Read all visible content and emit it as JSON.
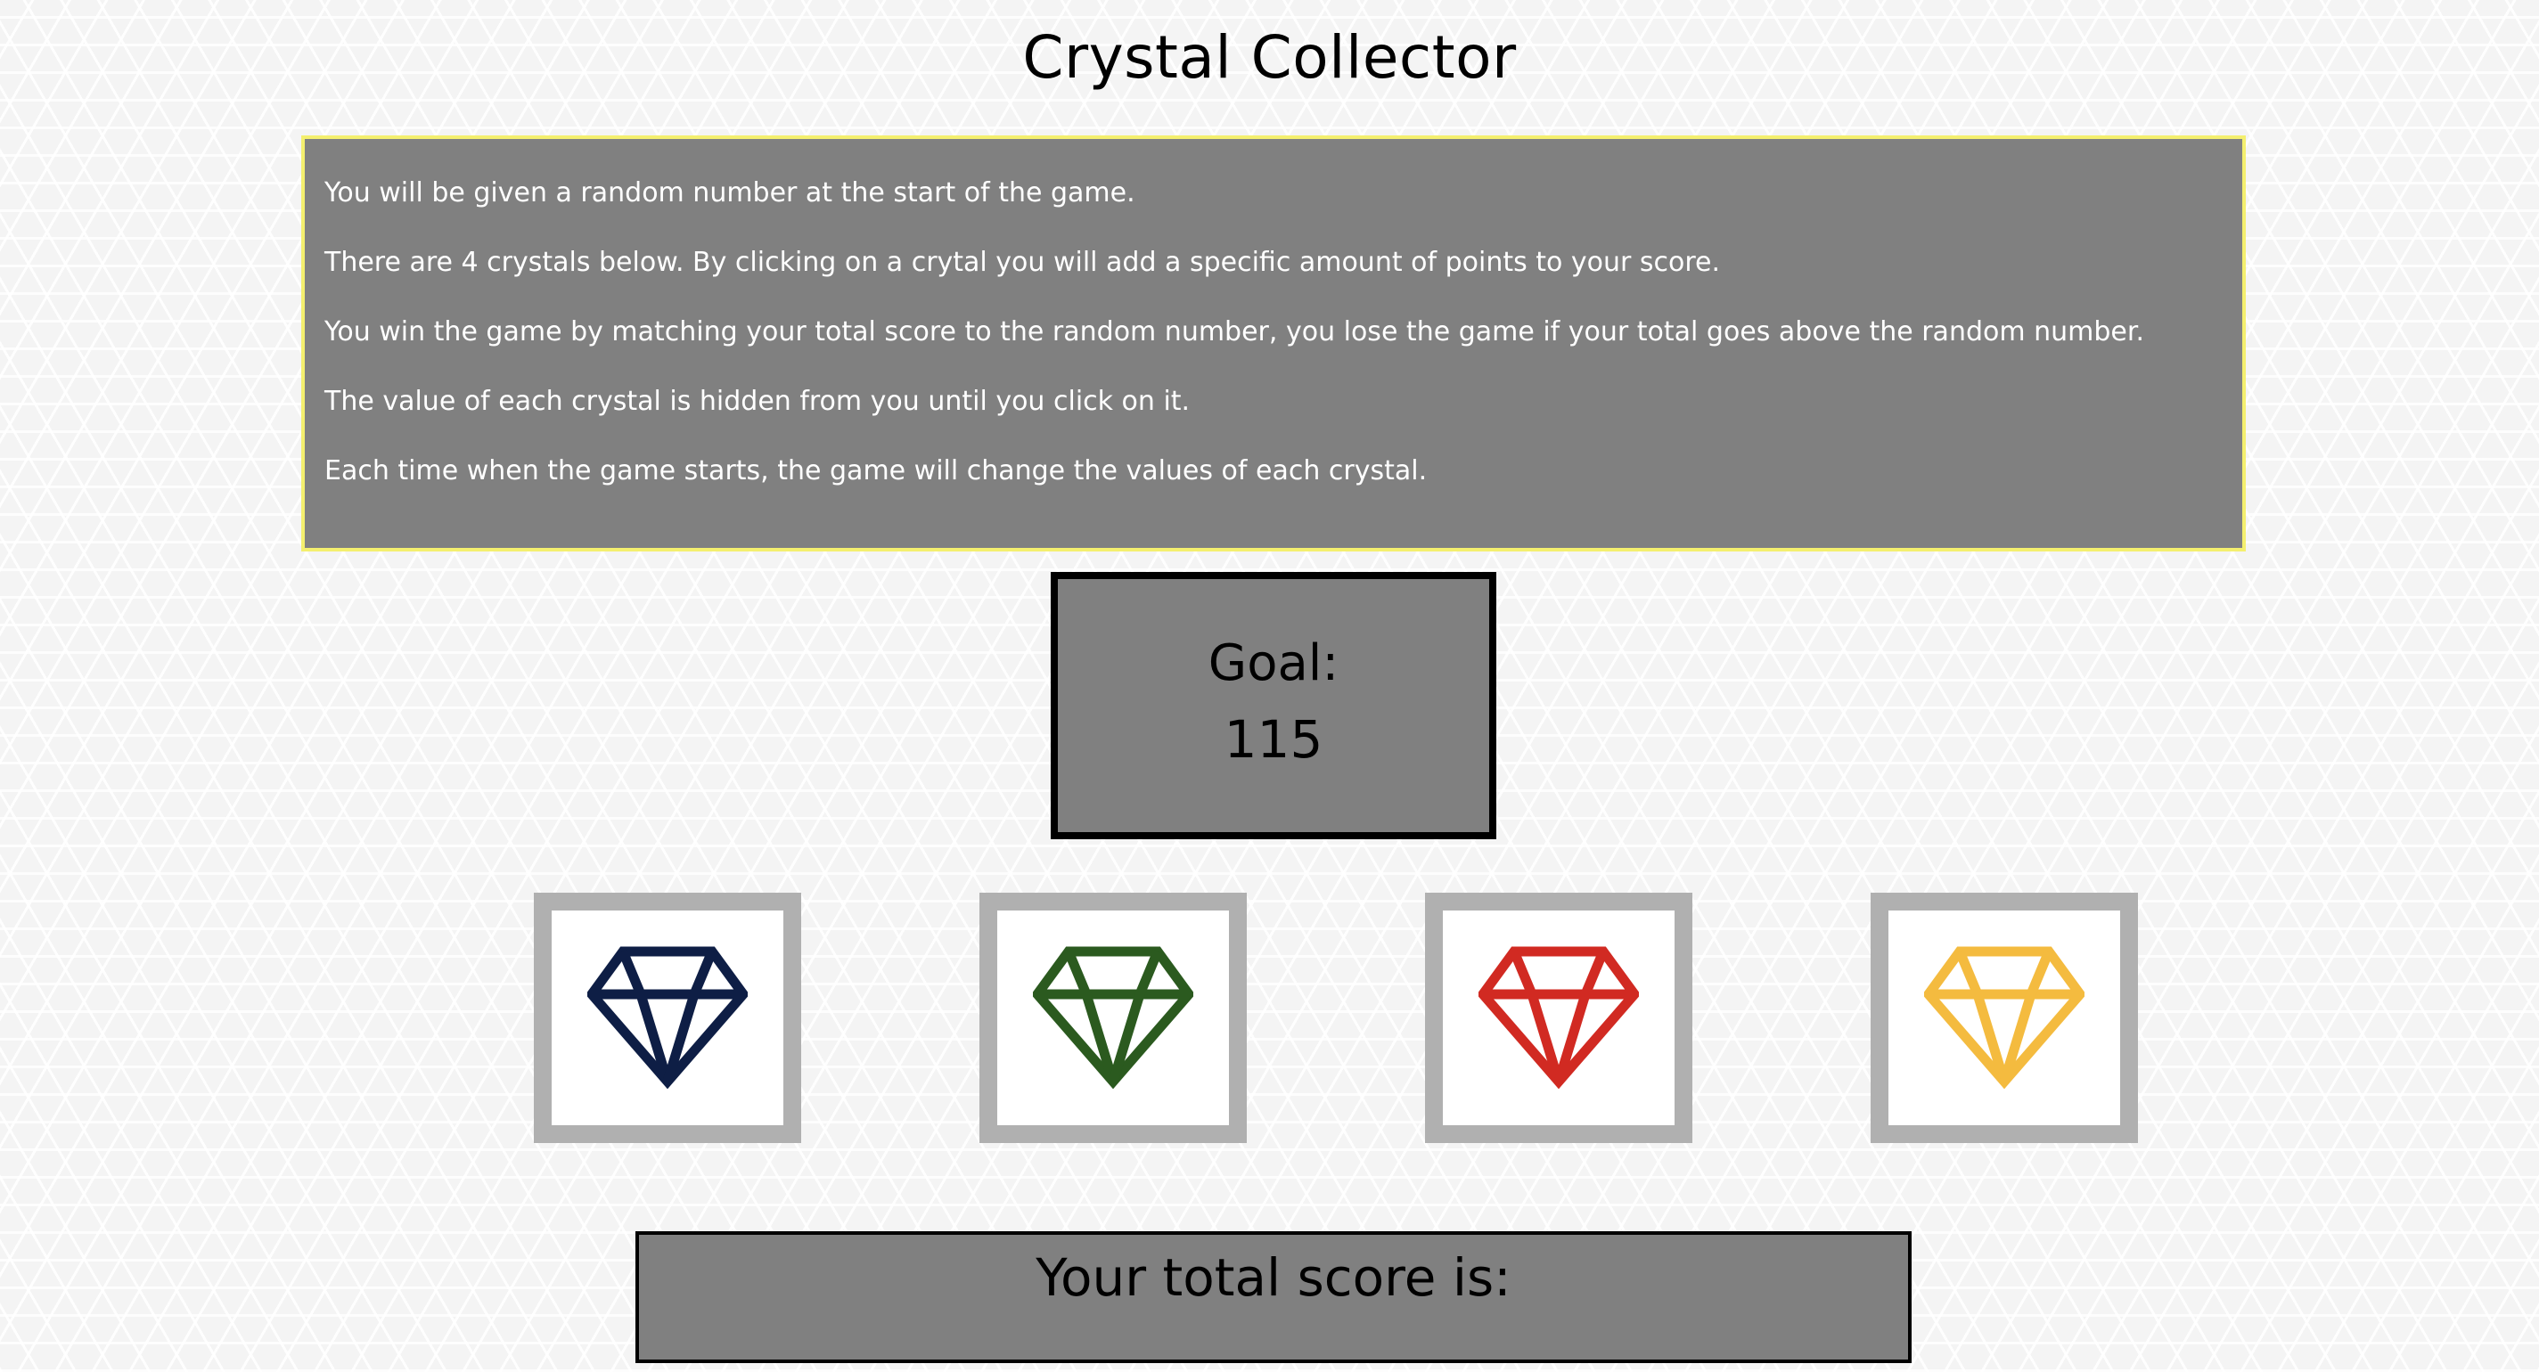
{
  "page": {
    "title": "Crystal Collector"
  },
  "instructions": [
    "You will be given a random number at the start of the game.",
    "There are 4 crystals below. By clicking on a crytal you will add a specific amount of points to your score.",
    "You win the game by matching your total score to the random number, you lose the game if your total goes above the random number.",
    "The value of each crystal is hidden from you until you click on it.",
    "Each time when the game starts, the game will change the values of each crystal."
  ],
  "goal": {
    "label": "Goal:",
    "value": "115"
  },
  "crystals": [
    {
      "icon": "diamond-icon",
      "color": "#0e1e45"
    },
    {
      "icon": "diamond-icon",
      "color": "#2b5a1f"
    },
    {
      "icon": "diamond-icon",
      "color": "#d12a22"
    },
    {
      "icon": "diamond-icon",
      "color": "#f4bb3f"
    }
  ],
  "score": {
    "label": "Your total score is:"
  },
  "colors": {
    "panel_background": "#808080",
    "instructions_border": "#f4ef6e",
    "crystal_frame": "#b0b0b0"
  }
}
